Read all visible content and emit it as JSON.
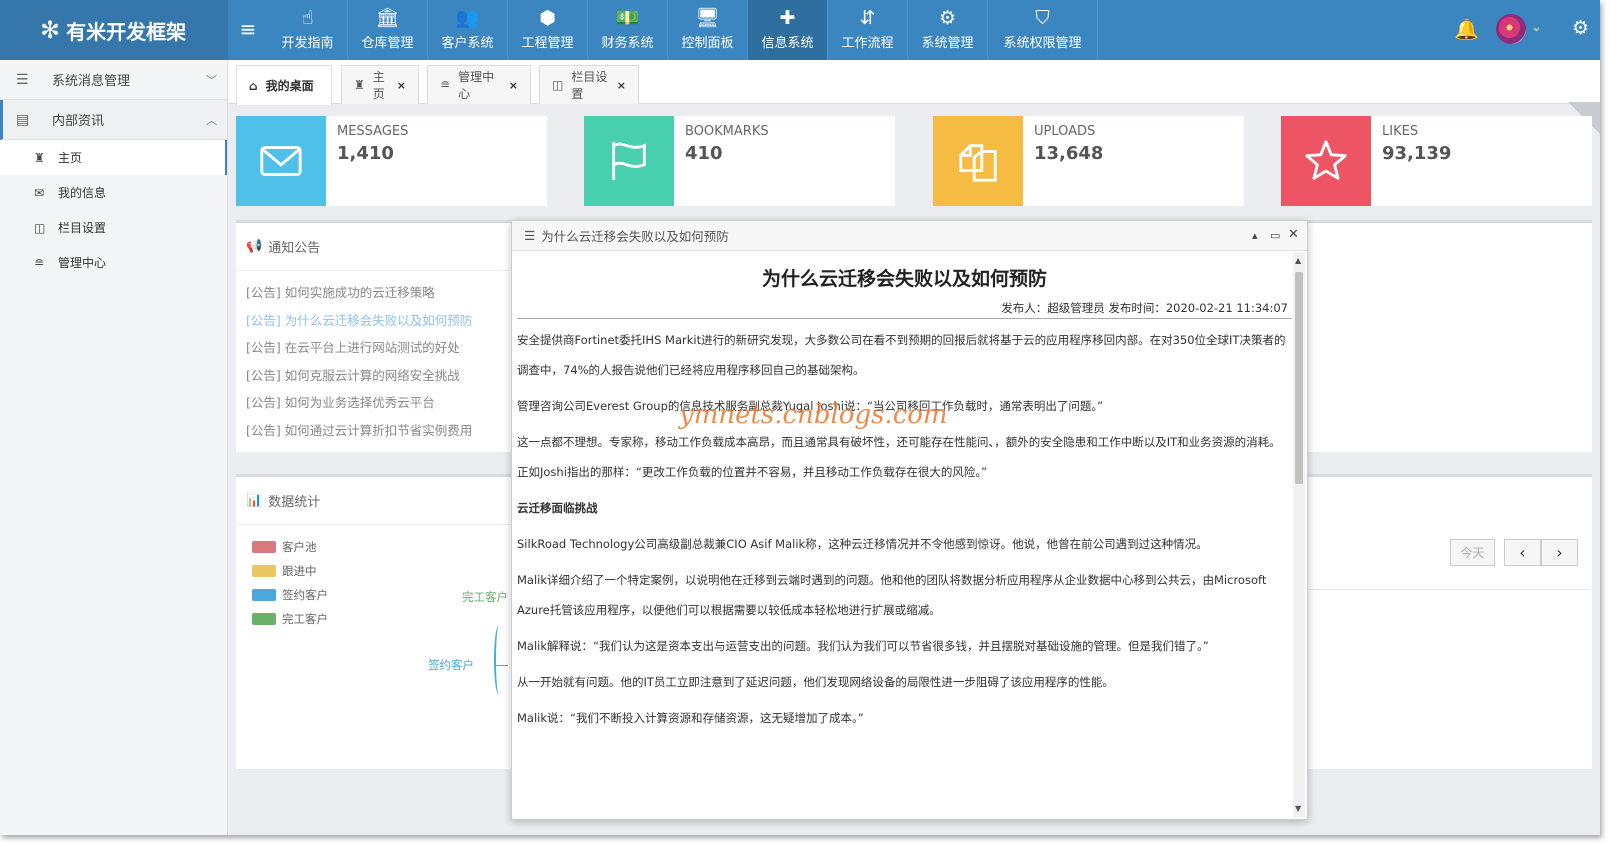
{
  "app": {
    "title": "有米开发框架"
  },
  "topnav": [
    {
      "label": "开发指南",
      "icon": "pointer-hand-icon",
      "glyph": "☝"
    },
    {
      "label": "仓库管理",
      "icon": "bank-icon",
      "glyph": "🏛"
    },
    {
      "label": "客户系统",
      "icon": "users-icon",
      "glyph": "👥"
    },
    {
      "label": "工程管理",
      "icon": "cube-icon",
      "glyph": "⬢"
    },
    {
      "label": "财务系统",
      "icon": "money-icon",
      "glyph": "💵"
    },
    {
      "label": "控制面板",
      "icon": "desktop-icon",
      "glyph": "🖥"
    },
    {
      "label": "信息系统",
      "icon": "puzzle-icon",
      "glyph": "✚"
    },
    {
      "label": "工作流程",
      "icon": "sort-icon",
      "glyph": "⇵"
    },
    {
      "label": "系统管理",
      "icon": "gears-icon",
      "glyph": "⚙"
    },
    {
      "label": "系统权限管理",
      "icon": "shield-icon",
      "glyph": "⛉"
    }
  ],
  "sidebar": {
    "groups": [
      {
        "label": "系统消息管理"
      },
      {
        "label": "内部资讯"
      }
    ],
    "items": [
      {
        "label": "主页"
      },
      {
        "label": "我的信息"
      },
      {
        "label": "栏目设置"
      },
      {
        "label": "管理中心"
      }
    ]
  },
  "tabs": [
    {
      "label": "我的桌面"
    },
    {
      "label": "主页"
    },
    {
      "label": "管理中心"
    },
    {
      "label": "栏目设置"
    }
  ],
  "stats": [
    {
      "label": "MESSAGES",
      "value": "1,410",
      "color": "#4fc1e9"
    },
    {
      "label": "BOOKMARKS",
      "value": "410",
      "color": "#48cfad"
    },
    {
      "label": "UPLOADS",
      "value": "13,648",
      "color": "#f6bb42"
    },
    {
      "label": "LIKES",
      "value": "93,139",
      "color": "#ed5565"
    }
  ],
  "notice": {
    "title": "通知公告",
    "items": [
      "[公告] 如何实施成功的云迁移策略",
      "[公告] 为什么云迁移会失败以及如何预防",
      "[公告] 在云平台上进行网站测试的好处",
      "[公告] 如何克服云计算的网络安全挑战",
      "[公告] 如何为业务选择优秀云平台",
      "[公告] 如何通过云计算折扣节省实例费用"
    ]
  },
  "stats_panel": {
    "title": "数据统计",
    "legend": [
      {
        "label": "客户池",
        "color": "#d9797b"
      },
      {
        "label": "跟进中",
        "color": "#e9c863"
      },
      {
        "label": "签约客户",
        "color": "#4aa8dc"
      },
      {
        "label": "完工客户",
        "color": "#6ab06a"
      }
    ],
    "pie_labels": [
      "完工客户",
      "签约客户"
    ]
  },
  "calendar": {
    "today": "今天",
    "prev": "‹",
    "next": "›"
  },
  "dialog": {
    "header": "为什么云迁移会失败以及如何预防",
    "title": "为什么云迁移会失败以及如何预防",
    "meta": "发布人：超级管理员 发布时间：2020-02-21 11:34:07",
    "watermark": "ymnets.cnblogs.com",
    "paragraphs": [
      "安全提供商Fortinet委托IHS Markit进行的新研究发现，大多数公司在看不到预期的回报后就将基于云的应用程序移回内部。在对350位全球IT决策者的调查中，74%的人报告说他们已经将应用程序移回自己的基础架构。",
      "管理咨询公司Everest Group的信息技术服务副总裁Yugal Joshi说：“当公司移回工作负载时，通常表明出了问题。”",
      "这一点都不理想。专家称，移动工作负载成本高昂，而且通常具有破坏性，还可能存在性能问、，额外的安全隐患和工作中断以及IT和业务资源的消耗。正如Joshi指出的那样：“更改工作负载的位置并不容易，并且移动工作负载存在很大的风险。”",
      "云迁移面临挑战",
      "SilkRoad Technology公司高级副总裁兼CIO Asif Malik称，这种云迁移情况并不令他感到惊讶。他说，他曾在前公司遇到过这种情况。",
      "Malik详细介绍了一个特定案例，以说明他在迁移到云端时遇到的问题。他和他的团队将数据分析应用程序从企业数据中心移到公共云，由Microsoft Azure托管该应用程序，以便他们可以根据需要以较低成本轻松地进行扩展或缩减。",
      "Malik解释说：“我们认为这是资本支出与运营支出的问题。我们认为我们可以节省很多钱，并且摆脱对基础设施的管理。但是我们错了。”",
      "从一开始就有问题。他的IT员工立即注意到了延迟问题，他们发现网络设备的局限性进一步阻碍了该应用程序的性能。",
      "Malik说：“我们不断投入计算资源和存储资源，这无疑增加了成本。”"
    ]
  }
}
